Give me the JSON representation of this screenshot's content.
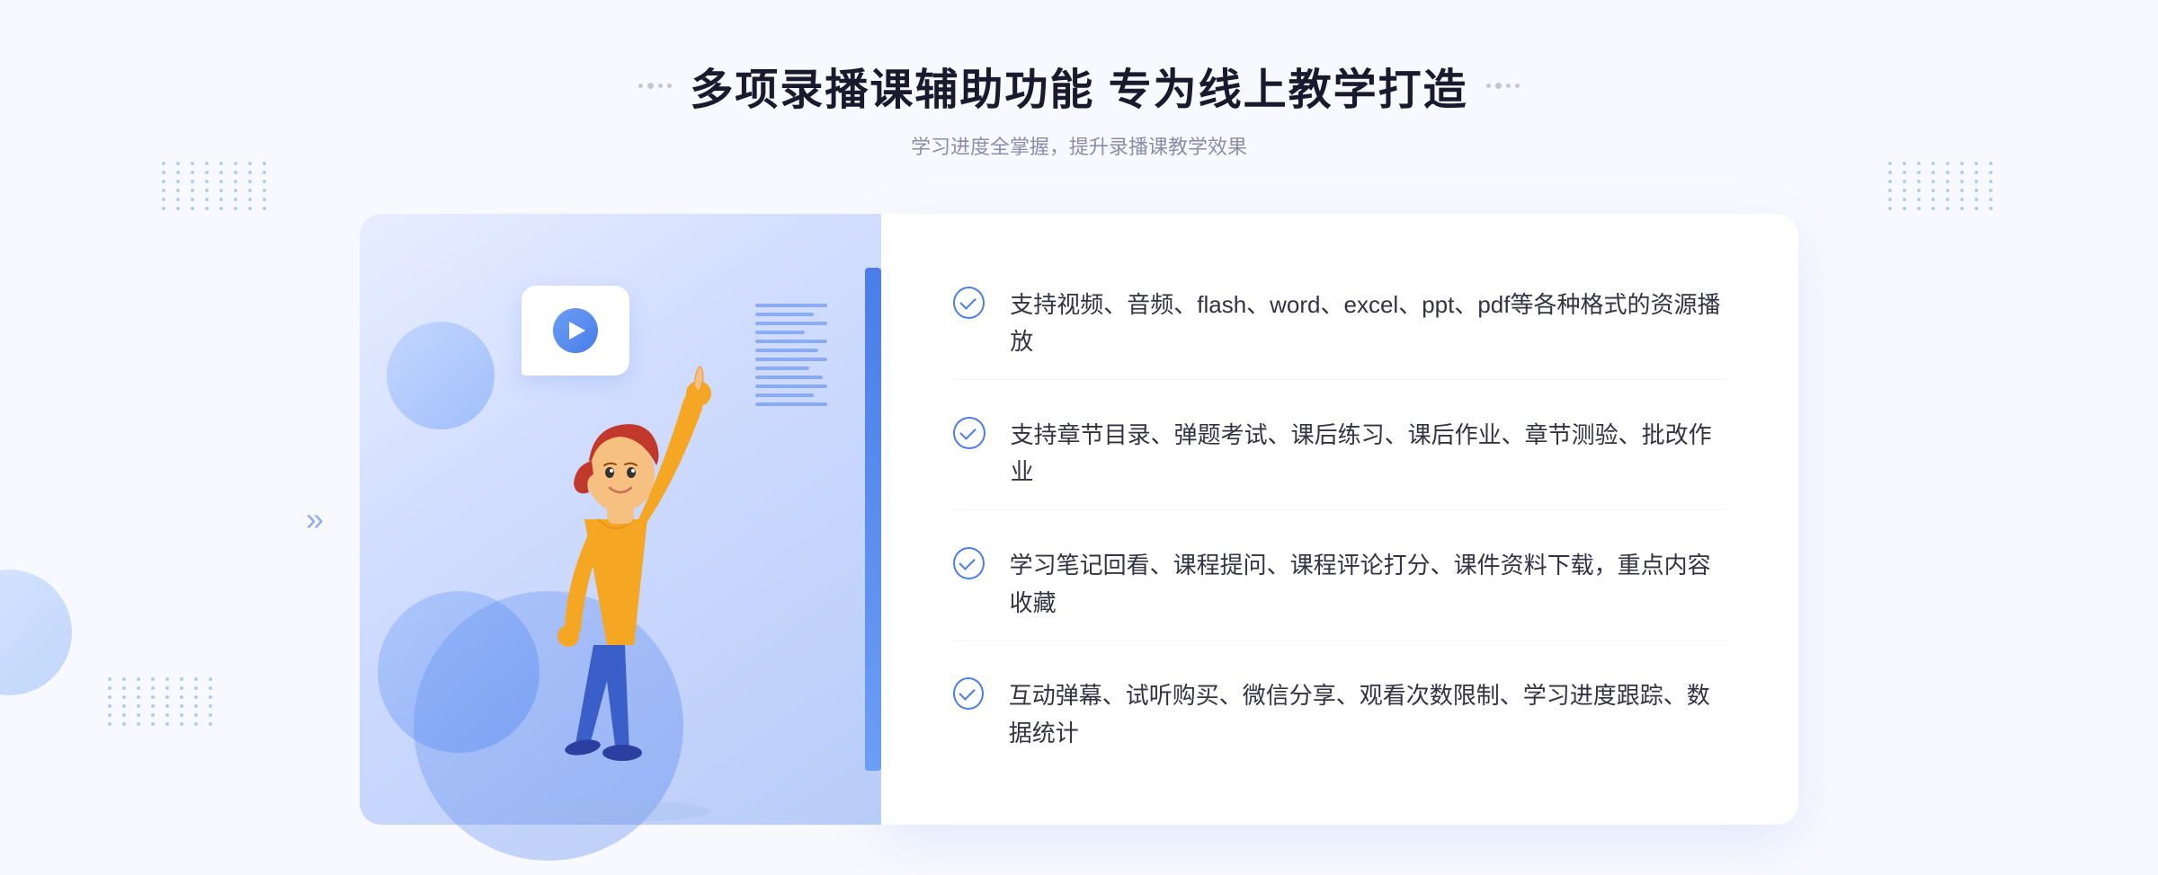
{
  "page": {
    "background": "#f8f9ff"
  },
  "header": {
    "title": "多项录播课辅助功能 专为线上教学打造",
    "subtitle": "学习进度全掌握，提升录播课教学效果"
  },
  "features": [
    {
      "id": 1,
      "text": "支持视频、音频、flash、word、excel、ppt、pdf等各种格式的资源播放"
    },
    {
      "id": 2,
      "text": "支持章节目录、弹题考试、课后练习、课后作业、章节测验、批改作业"
    },
    {
      "id": 3,
      "text": "学习笔记回看、课程提问、课程评论打分、课件资料下载，重点内容收藏"
    },
    {
      "id": 4,
      "text": "互动弹幕、试听购买、微信分享、观看次数限制、学习进度跟踪、数据统计"
    }
  ],
  "illustration": {
    "alt": "教学人物插图"
  },
  "decorators": {
    "left_arrow": "»",
    "play_button_aria": "播放按钮"
  }
}
